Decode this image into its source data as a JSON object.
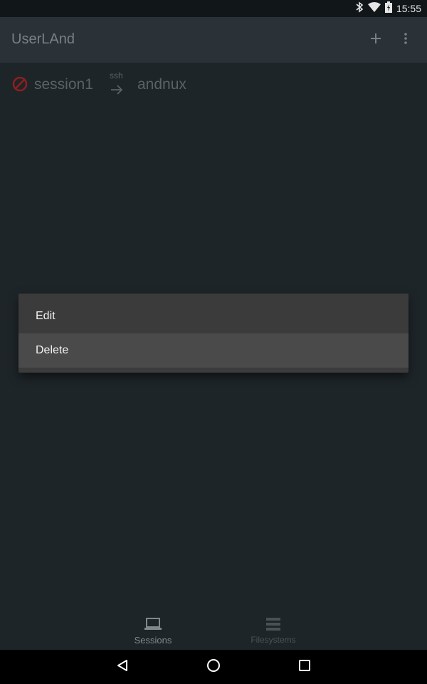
{
  "status_bar": {
    "time": "15:55",
    "icons": [
      "bluetooth-icon",
      "wifi-icon",
      "battery-icon"
    ]
  },
  "app_bar": {
    "title": "UserLAnd",
    "actions": [
      "add-icon",
      "more-vert-icon"
    ]
  },
  "sessions": [
    {
      "name": "session1",
      "protocol": "ssh",
      "filesystem": "andnux",
      "status_icon": "blocked-icon"
    }
  ],
  "context_menu": {
    "items": [
      {
        "label": "Edit"
      },
      {
        "label": "Delete",
        "highlighted": true
      }
    ]
  },
  "bottom_nav": {
    "items": [
      {
        "label": "Sessions",
        "icon": "laptop-icon",
        "active": true
      },
      {
        "label": "Filesystems",
        "icon": "storage-icon",
        "active": false
      }
    ]
  },
  "system_nav": [
    "back-icon",
    "home-icon",
    "recents-icon"
  ],
  "colors": {
    "background": "#1e2529",
    "app_bar": "#2a3237",
    "menu_bg": "#3b3b3b",
    "menu_highlight": "#4a4a4a",
    "blocked": "#8e1f1f"
  }
}
